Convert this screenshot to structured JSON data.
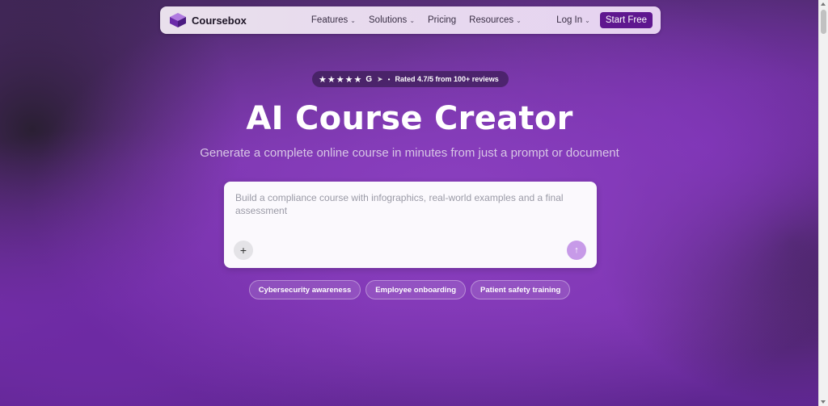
{
  "nav": {
    "brand": "Coursebox",
    "links": [
      {
        "label": "Features",
        "dropdown": true
      },
      {
        "label": "Solutions",
        "dropdown": true
      },
      {
        "label": "Pricing",
        "dropdown": false
      },
      {
        "label": "Resources",
        "dropdown": true
      }
    ],
    "login_label": "Log In",
    "cta_label": "Start Free"
  },
  "rating": {
    "stars": "★★★★★",
    "text": "Rated 4.7/5 from 100+ reviews"
  },
  "hero": {
    "title": "AI Course Creator",
    "subtitle": "Generate a complete online course in minutes from just a prompt or document"
  },
  "prompt": {
    "placeholder": "Build a compliance course with infographics, real-world examples and a final assessment",
    "add_icon": "plus-icon",
    "send_icon": "arrow-up-icon"
  },
  "chips": [
    "Cybersecurity awareness",
    "Employee onboarding",
    "Patient safety training"
  ],
  "colors": {
    "accent": "#5f178f",
    "send": "#c79ae8"
  }
}
